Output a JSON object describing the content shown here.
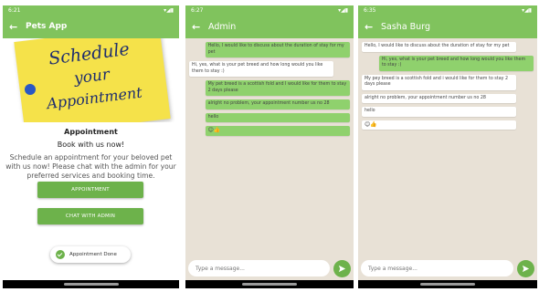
{
  "screen1": {
    "status_time": "6:21",
    "title": "Pets App",
    "banner_lines": [
      "Schedule",
      "your",
      "Appointment"
    ],
    "heading": "Appointment",
    "subheading": "Book with us now!",
    "description": "Schedule an appointment for your beloved pet with us now! Please chat with the admin for your preferred services and booking time.",
    "appointment_button": "APPOINTMENT",
    "chat_button": "CHAT WITH ADMIN",
    "done_button": "Appointment Done"
  },
  "screen2": {
    "status_time": "6:27",
    "title": "Admin",
    "messages": [
      {
        "side": "out",
        "text": "Hello, I would like to discuss about the duration of stay for my pet"
      },
      {
        "side": "in",
        "text": "Hi, yes, what is your pet breed and how long would you like them to stay :)"
      },
      {
        "side": "out",
        "text": "My pet breed is a scottish fold and I would like for them to stay 2 days please"
      },
      {
        "side": "out",
        "text": "alright no problem, your appointment number us no 28"
      },
      {
        "side": "out",
        "text": "hello"
      },
      {
        "side": "out",
        "text": "😊👍"
      }
    ],
    "input_placeholder": "Type a message..."
  },
  "screen3": {
    "status_time": "6:35",
    "title": "Sasha Burg",
    "messages": [
      {
        "side": "in",
        "text": "Hello, I would like to discuss about the duration of stay for my pet"
      },
      {
        "side": "out",
        "text": "Hi, yes, what is your pet breed and how long would you like them to stay :)"
      },
      {
        "side": "in",
        "text": "My pey breed is a scottish fold and i would like for them to stay 2 days please"
      },
      {
        "side": "in",
        "text": "alright no problem, your appointment number us no 28"
      },
      {
        "side": "in",
        "text": "hello"
      },
      {
        "side": "in",
        "text": "😊👍"
      }
    ],
    "input_placeholder": "Type a message..."
  },
  "colors": {
    "primary": "#80c35d",
    "button": "#6db24b",
    "outgoing_bubble": "#8fd16d",
    "chat_background": "#e8e1d6"
  },
  "icons": [
    "back-arrow-icon",
    "send-icon",
    "check-icon",
    "wifi-icon",
    "battery-icon"
  ]
}
